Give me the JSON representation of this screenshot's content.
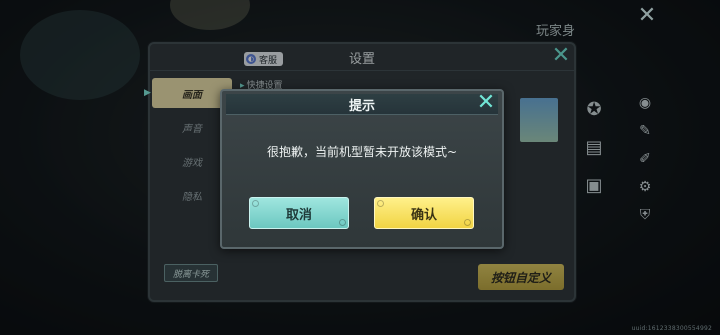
{
  "settings": {
    "title": "设置",
    "service_label": "客服",
    "tabs": [
      "画面",
      "声音",
      "游戏",
      "隐私"
    ],
    "quick_setting": "快捷设置",
    "exit_stuck_label": "脱离卡死",
    "custom_button_label": "按钮自定义"
  },
  "hud": {
    "label": "玩家身",
    "uid": "uuid:1612338300554992"
  },
  "modal": {
    "title": "提示",
    "message": "很抱歉，当前机型暂未开放该模式~",
    "cancel_label": "取消",
    "confirm_label": "确认"
  },
  "colors": {
    "accent": "#72e6d6",
    "confirm": "#f1d443",
    "cancel": "#6cc8c0"
  }
}
